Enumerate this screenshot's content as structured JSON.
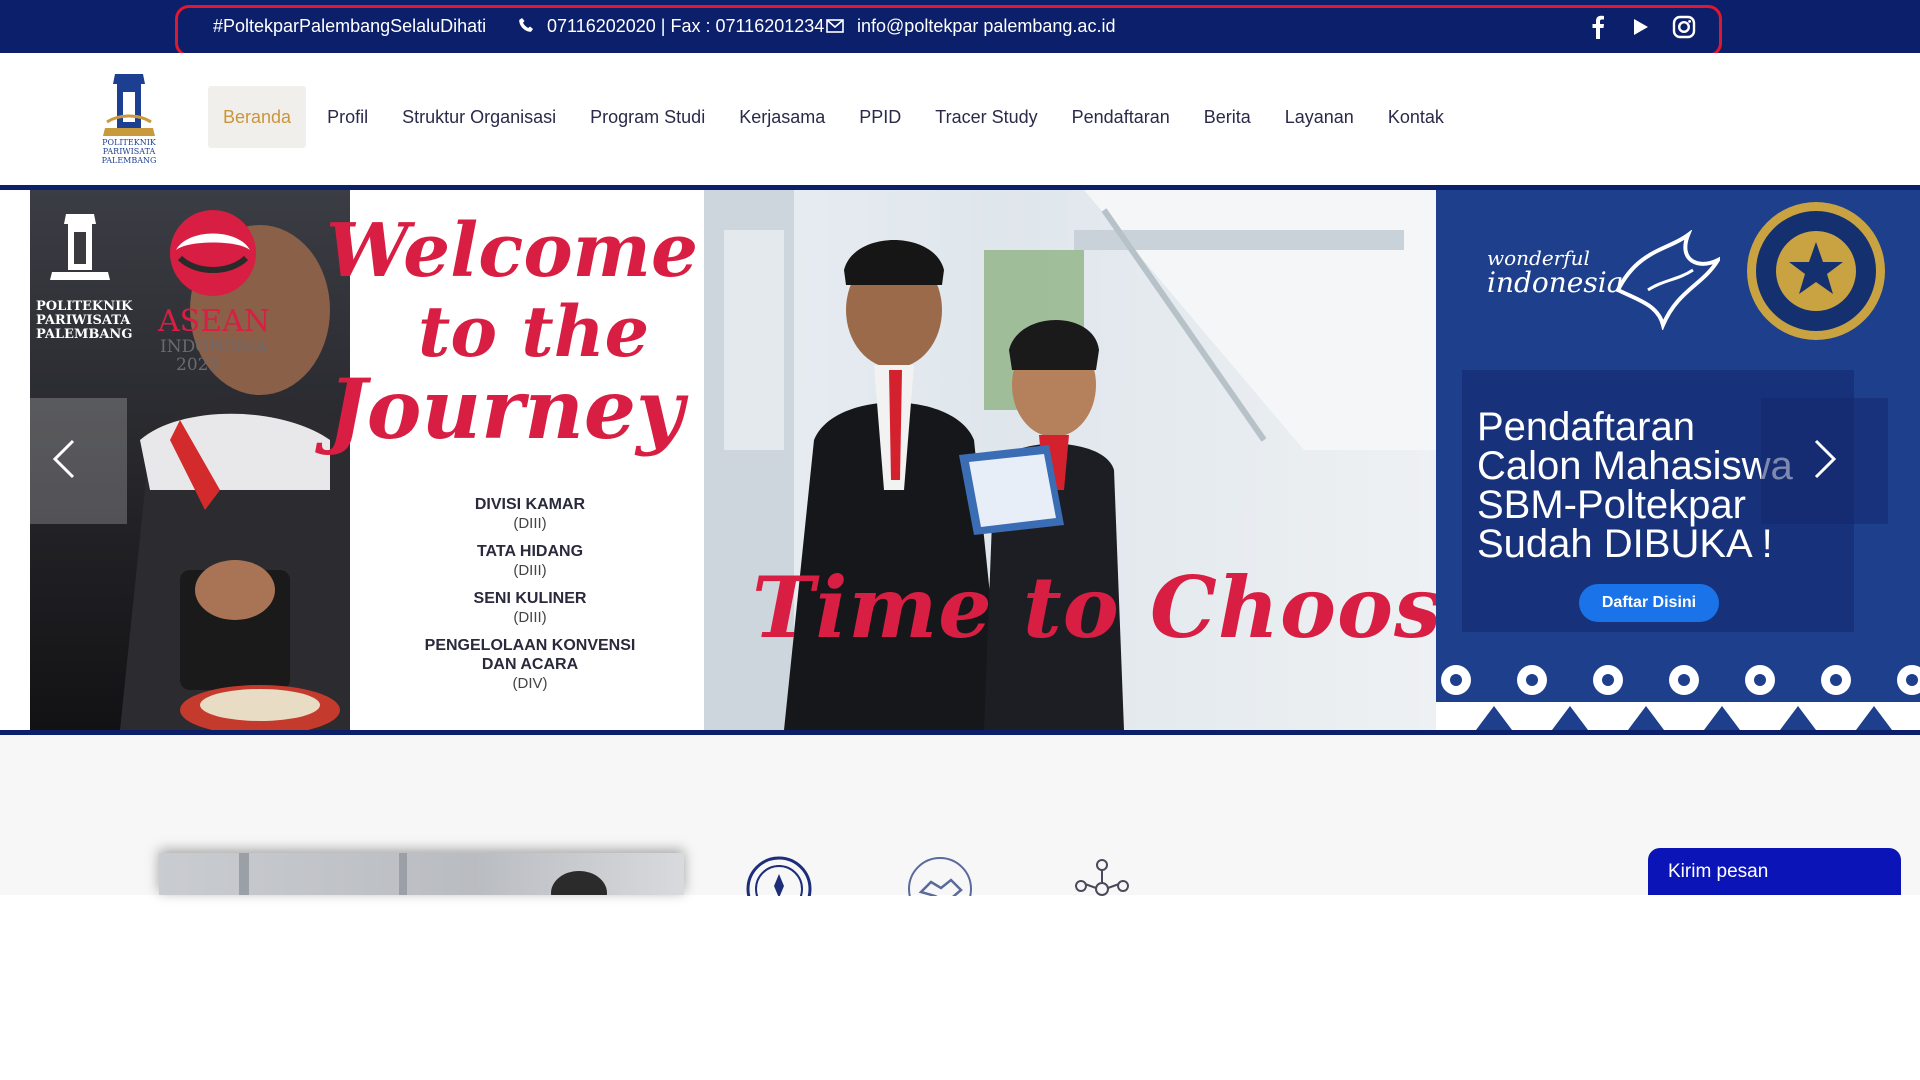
{
  "topbar": {
    "hashtag": "#PoltekparPalembangSelaluDihati",
    "phone": "07116202020 | Fax : 07116201234",
    "email": "info@poltekpar palembang.ac.id",
    "social": [
      "facebook-icon",
      "youtube-icon",
      "instagram-icon"
    ]
  },
  "logo": {
    "line1": "POLITEKNIK",
    "line2": "PARIWISATA",
    "line3": "PALEMBANG"
  },
  "nav": {
    "items": [
      "Beranda",
      "Profil",
      "Struktur Organisasi",
      "Program Studi",
      "Kerjasama",
      "PPID",
      "Tracer Study",
      "Pendaftaran",
      "Berita",
      "Layanan",
      "Kontak"
    ],
    "active": "Beranda"
  },
  "slide": {
    "panel1": {
      "logo_lines": [
        "POLITEKNIK",
        "PARIWISATA",
        "PALEMBANG"
      ],
      "asean": "ASEAN",
      "asean_sub": "INDONESIA",
      "asean_year": "2023"
    },
    "welcome": [
      "Welcome",
      "to the",
      "Journey"
    ],
    "programs": [
      {
        "name": "DIVISI KAMAR",
        "level": "(DIII)"
      },
      {
        "name": "TATA HIDANG",
        "level": "(DIII)"
      },
      {
        "name": "SENI KULINER",
        "level": "(DIII)"
      },
      {
        "name": "PENGELOLAAN KONVENSI DAN ACARA",
        "level": "(DIV)"
      }
    ],
    "tagline": "Time to Choose",
    "wonderful_line1": "wonderful",
    "wonderful_line2": "indonesia",
    "registration": {
      "line1": "Pendaftaran",
      "line2": "Calon Mahasiswa",
      "line3": "SBM-Poltekpar",
      "line4": "Sudah DIBUKA !",
      "button": "Daftar Disini"
    }
  },
  "chat": {
    "label": "Kirim pesan"
  },
  "colors": {
    "navy": "#0b1f6a",
    "accent_red": "#d81f43",
    "active_nav": "#c9963a",
    "button_blue": "#1a73e8",
    "chat_blue": "#0b14b6"
  }
}
